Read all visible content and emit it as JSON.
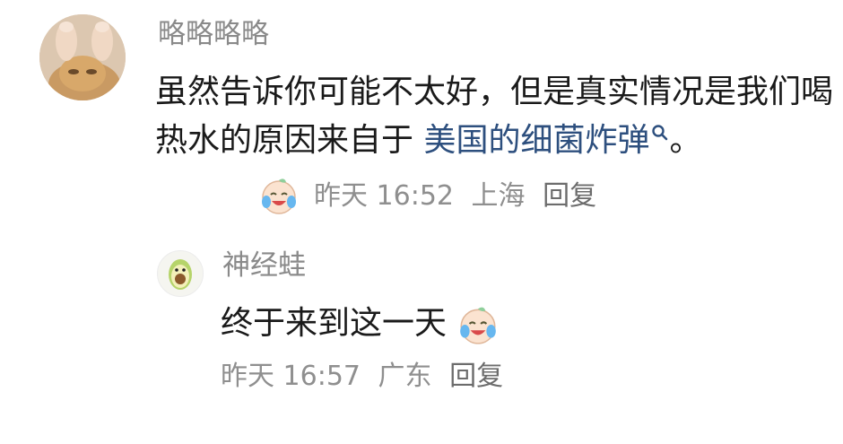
{
  "comments": [
    {
      "username": "略略略略",
      "text_before_link": "虽然告诉你可能不太好，但是真实情况是我们喝热水的原因来自于 ",
      "link_text": "美国的细菌炸弹",
      "text_after_link": "。",
      "emoji": "crying-laughing-emoji",
      "time": "昨天 16:52",
      "location": "上海",
      "reply_label": "回复"
    },
    {
      "username": "神经蛙",
      "text": "终于来到这一天",
      "emoji": "crying-laughing-emoji",
      "time": "昨天 16:57",
      "location": "广东",
      "reply_label": "回复"
    }
  ],
  "colors": {
    "username": "#8a8a8a",
    "link": "#2d4f7e",
    "meta": "#8f8f8f",
    "text": "#1a1a1a"
  }
}
